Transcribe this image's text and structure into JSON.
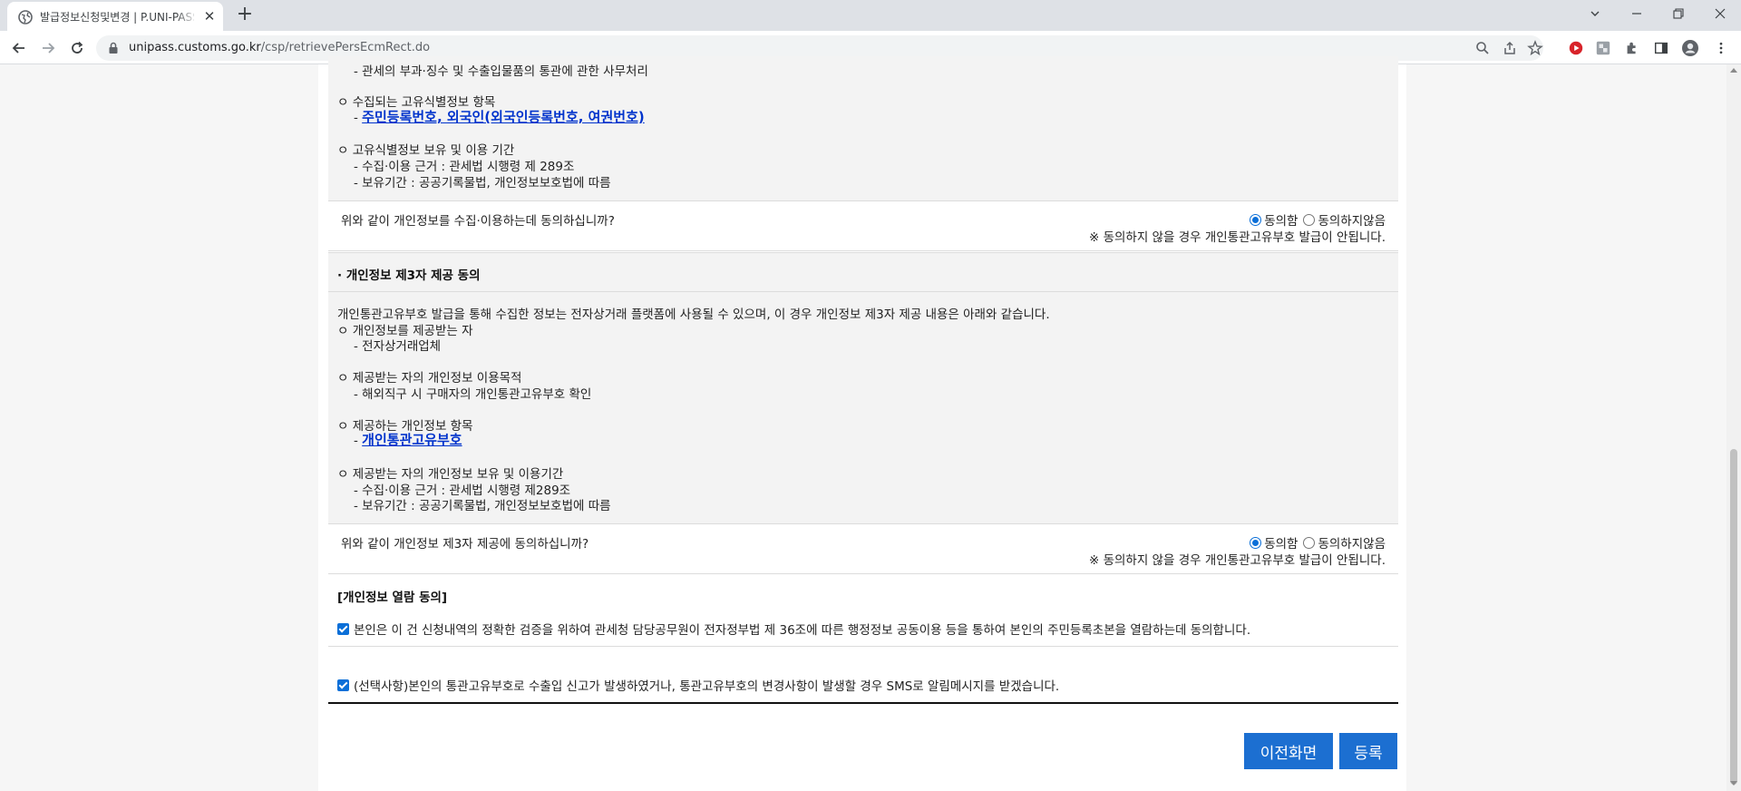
{
  "browser": {
    "tab_title": "발급정보신청및변경 | P.UNI-PASS",
    "url_host": "unipass.customs.go.kr",
    "url_path": "/csp/retrievePersEcmRect.do"
  },
  "section1": {
    "lines": [
      "- 관세의 부과·징수 및 수출입물품의 통관에 관한 사무처리",
      "ㅇ 수집되는 고유식별정보 항목",
      "ㅇ 고유식별정보 보유 및 이용 기간",
      "- 수집·이용 근거 : 관세법 시행령 제 289조",
      "- 보유기간 : 공공기록물법, 개인정보보호법에 따름"
    ],
    "item_prefix": "- ",
    "item_link": "주민등록번호, 외국인(외국인등록번호, 여권번호)",
    "question": "위와 같이 개인정보를 수집·이용하는데 동의하십니까?",
    "agree_label": "동의함",
    "disagree_label": "동의하지않음",
    "note": "※ 동의하지 않을 경우 개인통관고유부호 발급이 안됩니다."
  },
  "section2": {
    "heading": "· 개인정보 제3자 제공 동의",
    "lines": [
      "개인통관고유부호 발급을 통해 수집한 정보는 전자상거래 플랫폼에 사용될 수 있으며, 이 경우 개인정보 제3자 제공 내용은 아래와 같습니다.",
      "ㅇ 개인정보를 제공받는 자",
      "- 전자상거래업체",
      "ㅇ 제공받는 자의 개인정보 이용목적",
      "- 해외직구 시 구매자의 개인통관고유부호 확인",
      "ㅇ 제공하는 개인정보 항목",
      "ㅇ 제공받는 자의 개인정보 보유 및 이용기간",
      "- 수집·이용 근거 : 관세법 시행령 제289조",
      "- 보유기간 : 공공기록물법, 개인정보보호법에 따름"
    ],
    "item_prefix": "- ",
    "item_link": "개인통관고유부호",
    "question": "위와 같이 개인정보 제3자 제공에 동의하십니까?",
    "agree_label": "동의함",
    "disagree_label": "동의하지않음",
    "note": "※ 동의하지 않을 경우 개인통관고유부호 발급이 안됩니다."
  },
  "section3": {
    "heading": "[개인정보 열람 동의]",
    "consent_text": "본인은 이 건 신청내역의 정확한 검증을 위하여 관세청 담당공무원이 전자정부법 제 36조에 따른 행정정보 공동이용 등을 통하여 본인의 주민등록초본을 열람하는데 동의합니다.",
    "sms_text": "(선택사항)본인의 통관고유부호로 수출입 신고가 발생하였거나, 통관고유부호의 변경사항이 발생할 경우 SMS로 알림메시지를 받겠습니다."
  },
  "buttons": {
    "prev": "이전화면",
    "register": "등록"
  },
  "colors": {
    "accent": "#1c6fd1",
    "link": "#0033cc"
  }
}
